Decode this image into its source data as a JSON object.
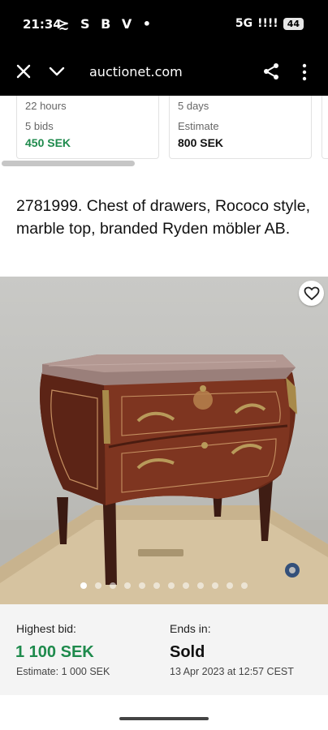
{
  "status_bar": {
    "time": "21:34",
    "left_icons": "≿ S B V •",
    "network": "5G",
    "signal": "!!!!",
    "battery": "44"
  },
  "browser": {
    "url": "auctionet.com",
    "icons": [
      "close-icon",
      "chevron-down-icon",
      "share-icon",
      "more-vertical-icon"
    ]
  },
  "related_cards": [
    {
      "time_left": "22 hours",
      "bids": "5 bids",
      "price": "450 SEK",
      "price_color": "#1e8a4c"
    },
    {
      "time_left": "5 days",
      "bids": "Estimate",
      "price": "800 SEK",
      "price_color": "#111111"
    }
  ],
  "lot": {
    "title": "2781999. Chest of drawers, Rococo style, marble top, branded Ryden möbler AB.",
    "image_count": 12,
    "active_image": 1
  },
  "bid": {
    "highest_bid_label": "Highest bid:",
    "highest_bid_value": "1 100 SEK",
    "estimate": "Estimate: 1 000 SEK",
    "ends_in_label": "Ends in:",
    "ends_status": "Sold",
    "ends_date": "13 Apr 2023 at 12:57 CEST"
  },
  "colors": {
    "bid_green": "#1e8a4c",
    "accent_dark": "#111111"
  }
}
